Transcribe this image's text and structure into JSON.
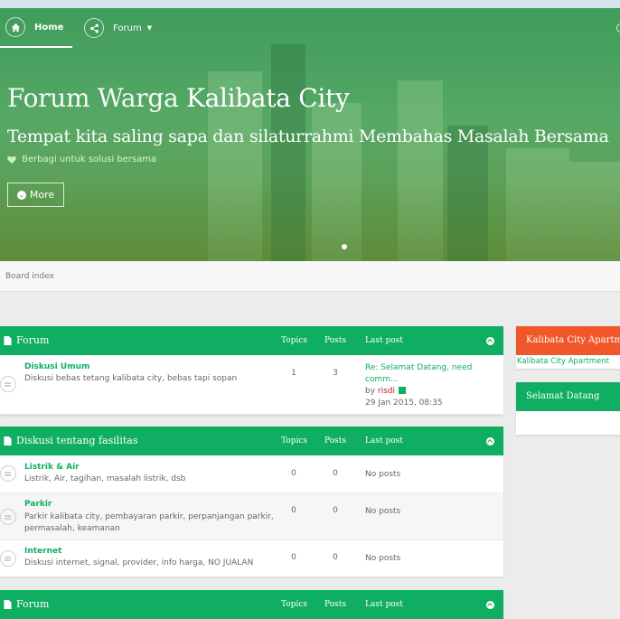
{
  "nav": {
    "home_label": "Home",
    "forum_label": "Forum",
    "home_icon": "home-icon",
    "forum_icon": "share-icon"
  },
  "hero": {
    "title_light": "Forum Warga",
    "title_strong": "Kalibata City",
    "subtitle": "Tempat kita saling sapa dan silaturrahmi Membahas Masalah Bersama",
    "tagline": "Berbagi untuk solusi bersama",
    "more_label": "More"
  },
  "breadcrumb": "Board index",
  "colors": {
    "accent": "#0fae62",
    "orange": "#f0572a",
    "user": "#bb2222"
  },
  "columns": {
    "topics": "Topics",
    "posts": "Posts",
    "last_post": "Last post"
  },
  "categories": [
    {
      "title": "Forum",
      "forums": [
        {
          "title": "Diskusi Umum",
          "desc": "Diskusi bebas tetang kalibata city, bebas tapi sopan",
          "topics": "1",
          "posts": "3",
          "last_post_title": "Re: Selamat Datang, need comm...",
          "last_post_by": "by",
          "last_post_user": "risdi",
          "last_post_time": "29 Jan 2015, 08:35"
        }
      ]
    },
    {
      "title": "Diskusi tentang fasilitas",
      "forums": [
        {
          "title": "Listrik & Air",
          "desc": "Listrik, Air, tagihan, masalah listrik, dsb",
          "topics": "0",
          "posts": "0",
          "last_post": "No posts"
        },
        {
          "title": "Parkir",
          "desc": "Parkir kalibata city, pembayaran parkir, perpanjangan parkir, permasalah, keamanan",
          "topics": "0",
          "posts": "0",
          "last_post": "No posts"
        },
        {
          "title": "Internet",
          "desc": "Diskusi internet, signal, provider, info harga, NO JUALAN",
          "topics": "0",
          "posts": "0",
          "last_post": "No posts"
        }
      ]
    },
    {
      "title": "Forum"
    }
  ],
  "sidebar": {
    "box1_title": "Kalibata City Apartment",
    "box1_link": "Kalibata City Apartment",
    "box2_title": "Selamat Datang"
  }
}
